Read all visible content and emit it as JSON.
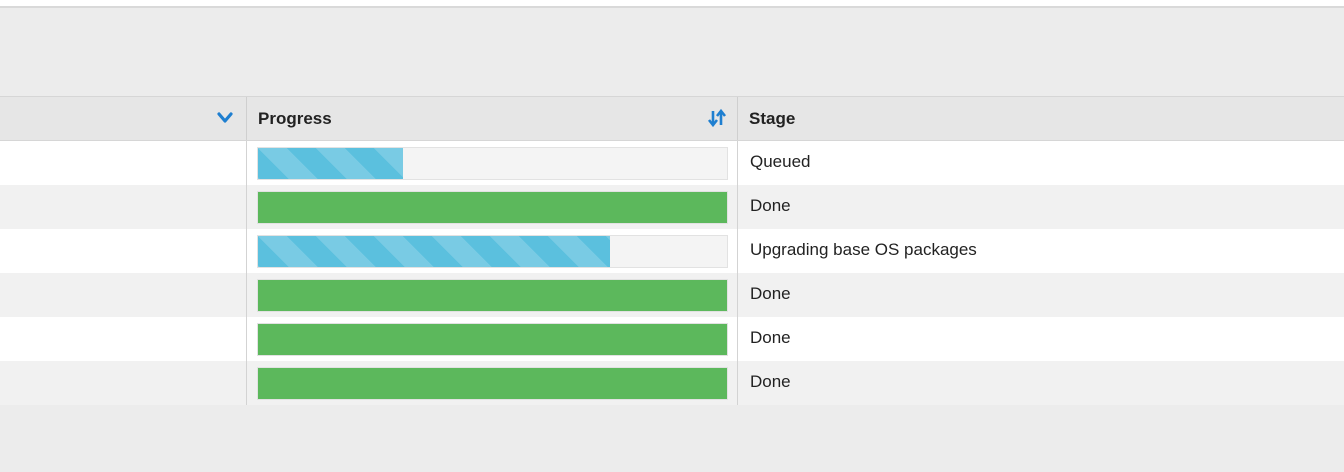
{
  "header": {
    "first_column_icon": "chevron-down-icon",
    "progress_label": "Progress",
    "progress_sort_icon": "sort-icon",
    "stage_label": "Stage"
  },
  "colors": {
    "done": "#5cb85c",
    "active": "#5bc0de",
    "accent": "#1f7fd0"
  },
  "rows": [
    {
      "progress": 0.31,
      "status": "active",
      "stage": "Queued"
    },
    {
      "progress": 1.0,
      "status": "done",
      "stage": "Done"
    },
    {
      "progress": 0.75,
      "status": "active",
      "stage": "Upgrading base OS packages"
    },
    {
      "progress": 1.0,
      "status": "done",
      "stage": "Done"
    },
    {
      "progress": 1.0,
      "status": "done",
      "stage": "Done"
    },
    {
      "progress": 1.0,
      "status": "done",
      "stage": "Done"
    }
  ]
}
